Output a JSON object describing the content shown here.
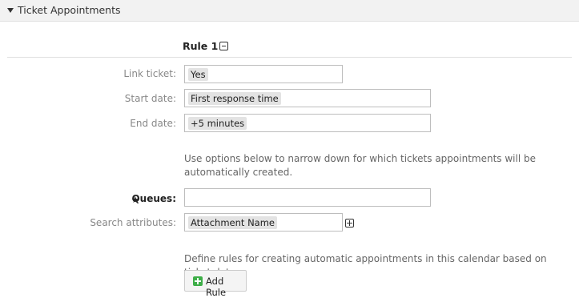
{
  "section": {
    "title": "Ticket Appointments"
  },
  "rule": {
    "title": "Rule 1"
  },
  "fields": {
    "link_ticket": {
      "label": "Link ticket:",
      "value": "Yes"
    },
    "start_date": {
      "label": "Start date:",
      "value": "First response time"
    },
    "end_date": {
      "label": "End date:",
      "value": "+5 minutes"
    },
    "queues": {
      "label": "Queues:",
      "required_marker": "★",
      "value": ""
    },
    "search_attributes": {
      "label": "Search attributes:",
      "value": "Attachment Name"
    }
  },
  "help": {
    "narrow_down": "Use options below to narrow down for which tickets appointments will be automatically created.",
    "define_rules": "Define rules for creating automatic appointments in this calendar based on ticket data."
  },
  "buttons": {
    "add_rule": "Add Rule"
  },
  "icons": {
    "section_toggle": "caret-down-icon",
    "remove_rule": "minus-square-icon",
    "add_attribute": "plus-square-icon",
    "add_rule": "plus-icon"
  },
  "colors": {
    "add_icon": "#3eae48",
    "header_bg": "#f2f2f2"
  }
}
